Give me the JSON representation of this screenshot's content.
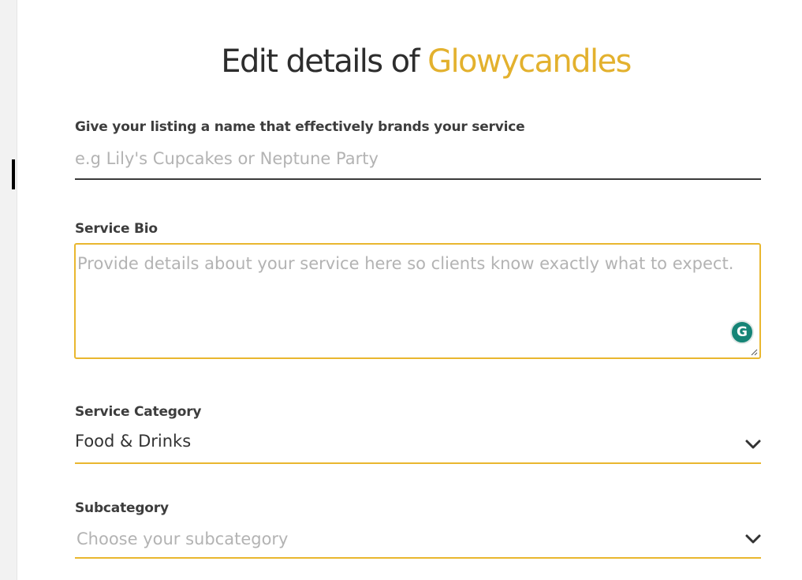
{
  "header": {
    "title_prefix": "Edit details of ",
    "brand_name": "Glowycandles"
  },
  "listing_name": {
    "label": "Give your listing a name that effectively brands your service",
    "placeholder": "e.g Lily's Cupcakes or Neptune Party",
    "value": ""
  },
  "service_bio": {
    "label": "Service Bio",
    "placeholder": "Provide details about your service here so clients know exactly what to expect.",
    "value": "",
    "grammarly_badge": "G"
  },
  "service_category": {
    "label": "Service Category",
    "selected": "Food & Drinks"
  },
  "subcategory": {
    "label": "Subcategory",
    "placeholder": "Choose your subcategory"
  },
  "colors": {
    "accent": "#e9b72f",
    "brand_text": "#e3b12e",
    "grammarly": "#158476"
  }
}
